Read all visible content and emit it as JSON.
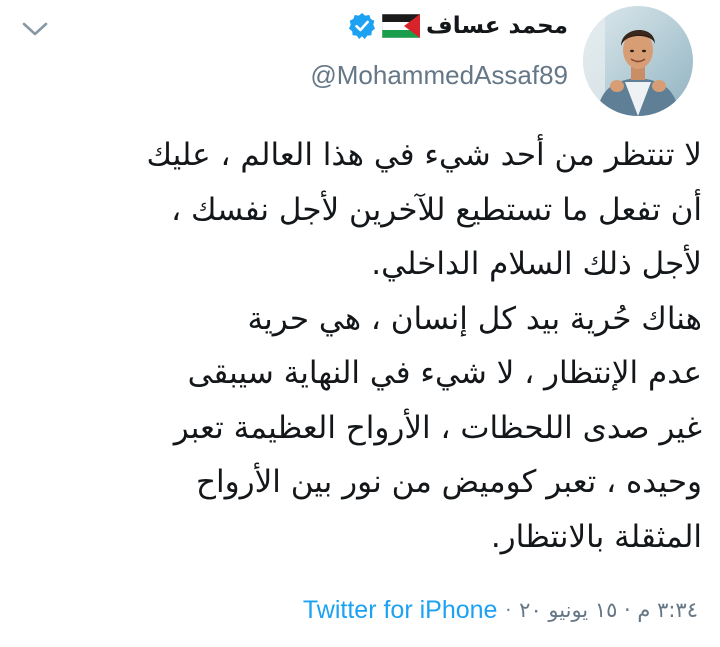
{
  "tweet": {
    "author": {
      "display_name": "محمد عساف",
      "handle": "@MohammedAssaf89",
      "verified": true,
      "flag": "palestine-flag"
    },
    "text_lines": [
      "لا تنتظر من أحد شيء في هذا العالم ، عليك",
      "أن تفعل ما تستطيع للآخرين لأجل نفسك ،",
      "لأجل ذلك السلام الداخلي.",
      "هناك حُرية بيد كل إنسان ، هي حرية",
      "عدم الإنتظار ، لا شيء في النهاية سيبقى",
      "غير صدى اللحظات ، الأرواح العظيمة تعبر",
      "وحيده ، تعبر كوميض من نور بين الأرواح",
      "المثقلة بالانتظار."
    ],
    "timestamp": "٣:٣٤ م · ١٥ يونيو ٢٠",
    "separator": "·",
    "source": "Twitter for iPhone"
  },
  "colors": {
    "accent": "#1da1f2",
    "secondary_text": "#657786",
    "primary_text": "#14171a",
    "verified": "#1da1f2"
  },
  "icons": {
    "menu": "chevron-down-icon",
    "verified": "verified-badge-icon",
    "flag": "palestine-flag-icon"
  }
}
